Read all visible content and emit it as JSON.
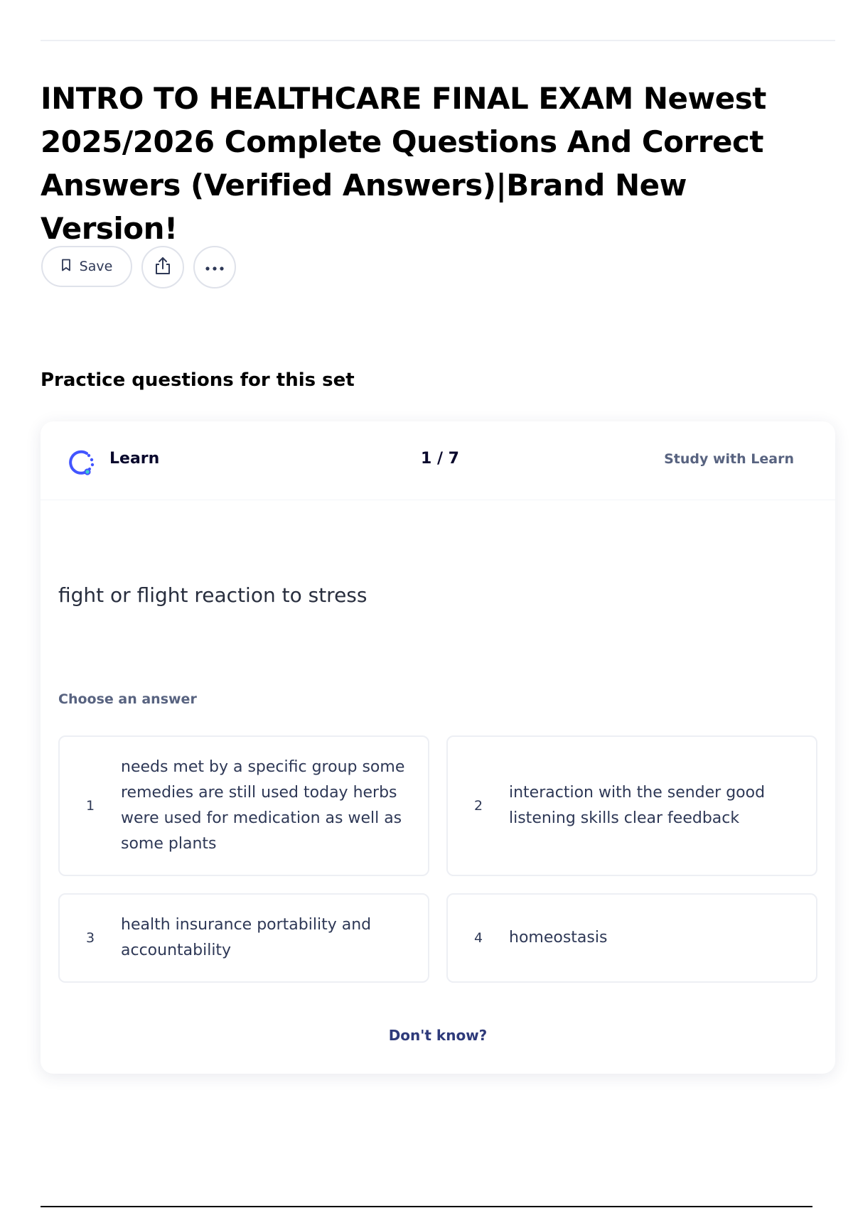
{
  "document": {
    "title": "INTRO TO HEALTHCARE FINAL EXAM Newest 2025/2026 Complete Questions And Correct Answers (Verified Answers)|Brand New Version!"
  },
  "actions": {
    "save_label": "Save",
    "share_icon": "share-icon",
    "more_icon": "more-icon"
  },
  "practice": {
    "heading": "Practice questions for this set",
    "mode_label": "Learn",
    "progress": "1 / 7",
    "study_link": "Study with Learn",
    "question": "fight or flight reaction to stress",
    "choose_label": "Choose an answer",
    "options": [
      {
        "number": "1",
        "text": "needs met by a specific group some remedies are still used today herbs were used for medication as well as some plants"
      },
      {
        "number": "2",
        "text": "interaction with the sender good listening skills clear feedback"
      },
      {
        "number": "3",
        "text": "health insurance portability and accountability"
      },
      {
        "number": "4",
        "text": "homeostasis"
      }
    ],
    "dont_know": "Don't know?"
  },
  "colors": {
    "accent": "#4255ff",
    "text_primary": "#0a092d",
    "text_secondary": "#586380",
    "border": "#edeff4"
  }
}
